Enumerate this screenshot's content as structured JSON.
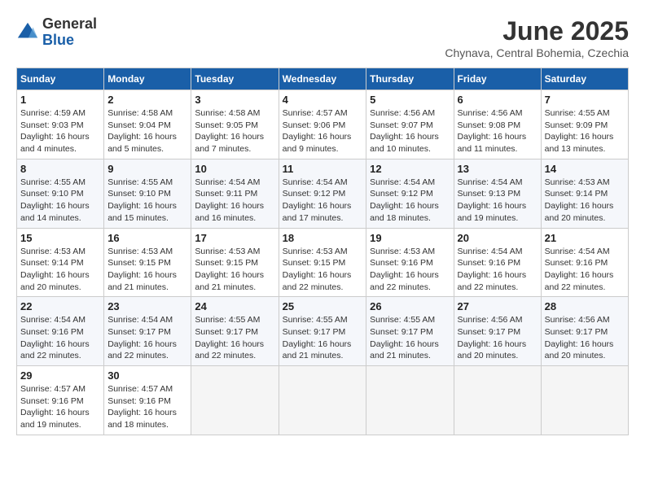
{
  "header": {
    "logo": {
      "line1": "General",
      "line2": "Blue"
    },
    "title": "June 2025",
    "subtitle": "Chynava, Central Bohemia, Czechia"
  },
  "calendar": {
    "days_of_week": [
      "Sunday",
      "Monday",
      "Tuesday",
      "Wednesday",
      "Thursday",
      "Friday",
      "Saturday"
    ],
    "weeks": [
      [
        {
          "day": "1",
          "sunrise": "4:59 AM",
          "sunset": "9:03 PM",
          "daylight": "16 hours and 4 minutes."
        },
        {
          "day": "2",
          "sunrise": "4:58 AM",
          "sunset": "9:04 PM",
          "daylight": "16 hours and 5 minutes."
        },
        {
          "day": "3",
          "sunrise": "4:58 AM",
          "sunset": "9:05 PM",
          "daylight": "16 hours and 7 minutes."
        },
        {
          "day": "4",
          "sunrise": "4:57 AM",
          "sunset": "9:06 PM",
          "daylight": "16 hours and 9 minutes."
        },
        {
          "day": "5",
          "sunrise": "4:56 AM",
          "sunset": "9:07 PM",
          "daylight": "16 hours and 10 minutes."
        },
        {
          "day": "6",
          "sunrise": "4:56 AM",
          "sunset": "9:08 PM",
          "daylight": "16 hours and 11 minutes."
        },
        {
          "day": "7",
          "sunrise": "4:55 AM",
          "sunset": "9:09 PM",
          "daylight": "16 hours and 13 minutes."
        }
      ],
      [
        {
          "day": "8",
          "sunrise": "4:55 AM",
          "sunset": "9:10 PM",
          "daylight": "16 hours and 14 minutes."
        },
        {
          "day": "9",
          "sunrise": "4:55 AM",
          "sunset": "9:10 PM",
          "daylight": "16 hours and 15 minutes."
        },
        {
          "day": "10",
          "sunrise": "4:54 AM",
          "sunset": "9:11 PM",
          "daylight": "16 hours and 16 minutes."
        },
        {
          "day": "11",
          "sunrise": "4:54 AM",
          "sunset": "9:12 PM",
          "daylight": "16 hours and 17 minutes."
        },
        {
          "day": "12",
          "sunrise": "4:54 AM",
          "sunset": "9:12 PM",
          "daylight": "16 hours and 18 minutes."
        },
        {
          "day": "13",
          "sunrise": "4:54 AM",
          "sunset": "9:13 PM",
          "daylight": "16 hours and 19 minutes."
        },
        {
          "day": "14",
          "sunrise": "4:53 AM",
          "sunset": "9:14 PM",
          "daylight": "16 hours and 20 minutes."
        }
      ],
      [
        {
          "day": "15",
          "sunrise": "4:53 AM",
          "sunset": "9:14 PM",
          "daylight": "16 hours and 20 minutes."
        },
        {
          "day": "16",
          "sunrise": "4:53 AM",
          "sunset": "9:15 PM",
          "daylight": "16 hours and 21 minutes."
        },
        {
          "day": "17",
          "sunrise": "4:53 AM",
          "sunset": "9:15 PM",
          "daylight": "16 hours and 21 minutes."
        },
        {
          "day": "18",
          "sunrise": "4:53 AM",
          "sunset": "9:15 PM",
          "daylight": "16 hours and 22 minutes."
        },
        {
          "day": "19",
          "sunrise": "4:53 AM",
          "sunset": "9:16 PM",
          "daylight": "16 hours and 22 minutes."
        },
        {
          "day": "20",
          "sunrise": "4:54 AM",
          "sunset": "9:16 PM",
          "daylight": "16 hours and 22 minutes."
        },
        {
          "day": "21",
          "sunrise": "4:54 AM",
          "sunset": "9:16 PM",
          "daylight": "16 hours and 22 minutes."
        }
      ],
      [
        {
          "day": "22",
          "sunrise": "4:54 AM",
          "sunset": "9:16 PM",
          "daylight": "16 hours and 22 minutes."
        },
        {
          "day": "23",
          "sunrise": "4:54 AM",
          "sunset": "9:17 PM",
          "daylight": "16 hours and 22 minutes."
        },
        {
          "day": "24",
          "sunrise": "4:55 AM",
          "sunset": "9:17 PM",
          "daylight": "16 hours and 22 minutes."
        },
        {
          "day": "25",
          "sunrise": "4:55 AM",
          "sunset": "9:17 PM",
          "daylight": "16 hours and 21 minutes."
        },
        {
          "day": "26",
          "sunrise": "4:55 AM",
          "sunset": "9:17 PM",
          "daylight": "16 hours and 21 minutes."
        },
        {
          "day": "27",
          "sunrise": "4:56 AM",
          "sunset": "9:17 PM",
          "daylight": "16 hours and 20 minutes."
        },
        {
          "day": "28",
          "sunrise": "4:56 AM",
          "sunset": "9:17 PM",
          "daylight": "16 hours and 20 minutes."
        }
      ],
      [
        {
          "day": "29",
          "sunrise": "4:57 AM",
          "sunset": "9:16 PM",
          "daylight": "16 hours and 19 minutes."
        },
        {
          "day": "30",
          "sunrise": "4:57 AM",
          "sunset": "9:16 PM",
          "daylight": "16 hours and 18 minutes."
        },
        null,
        null,
        null,
        null,
        null
      ]
    ],
    "labels": {
      "sunrise": "Sunrise: ",
      "sunset": "Sunset: ",
      "daylight": "Daylight: "
    }
  }
}
